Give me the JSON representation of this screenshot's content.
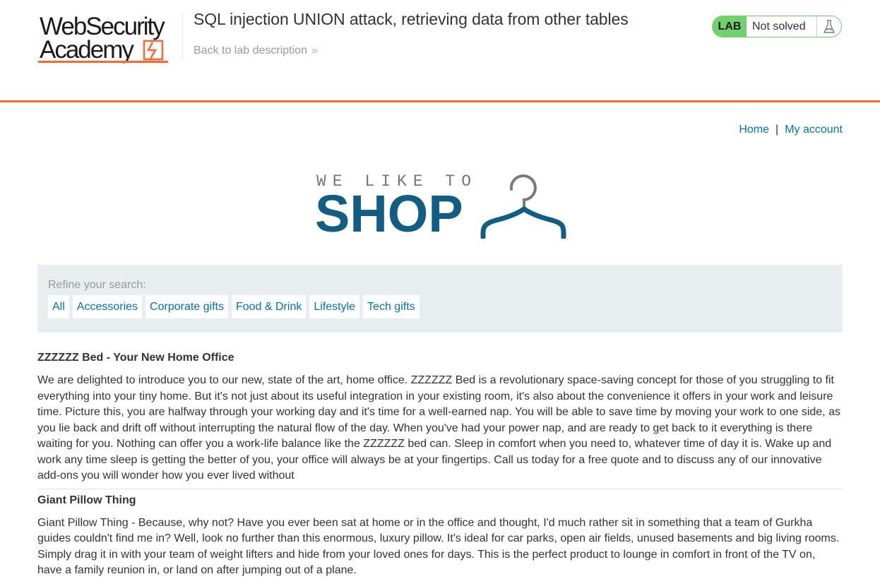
{
  "header": {
    "logo_line1": "WebSecurity",
    "logo_line2": "Academy",
    "lab_title": "SQL injection UNION attack, retrieving data from other tables",
    "back_link": "Back to lab description",
    "lab_badge": "LAB",
    "lab_status": "Not solved",
    "accent_color": "#ff6633",
    "status_color": "#70d16d",
    "flask_icon": "flask-icon"
  },
  "nav": {
    "home": "Home",
    "separator": "|",
    "my_account": "My account"
  },
  "banner": {
    "small": "WE LIKE TO",
    "big": "SHOP",
    "icon": "hanger-icon",
    "color": "#125d84"
  },
  "filter": {
    "label": "Refine your search:",
    "categories": [
      "All",
      "Accessories",
      "Corporate gifts",
      "Food & Drink",
      "Lifestyle",
      "Tech gifts"
    ]
  },
  "products": [
    {
      "title": "ZZZZZZ Bed - Your New Home Office",
      "description": "We are delighted to introduce you to our new, state of the art, home office. ZZZZZZ Bed is a revolutionary space-saving concept for those of you struggling to fit everything into your tiny home. But it's not just about its useful integration in your existing room, it's also about the convenience it offers in your work and leisure time. Picture this, you are halfway through your working day and it's time for a well-earned nap. You will be able to save time by moving your work to one side, as you lie back and drift off without interrupting the natural flow of the day. When you've had your power nap, and are ready to get back to it everything is there waiting for you. Nothing can offer you a work-life balance like the ZZZZZZ bed can. Sleep in comfort when you need to, whatever time of day it is. Wake up and work any time sleep is getting the better of you, your office will always be at your fingertips. Call us today for a free quote and to discuss any of our innovative add-ons you will wonder how you ever lived without"
    },
    {
      "title": "Giant Pillow Thing",
      "description": "Giant Pillow Thing - Because, why not? Have you ever been sat at home or in the office and thought, I'd much rather sit in something that a team of Gurkha guides couldn't find me in? Well, look no further than this enormous, luxury pillow. It's ideal for car parks, open air fields, unused basements and big living rooms. Simply drag it in with your team of weight lifters and hide from your loved ones for days. This is the perfect product to lounge in comfort in front of the TV on, have a family reunion in, or land on after jumping out of a plane."
    }
  ]
}
